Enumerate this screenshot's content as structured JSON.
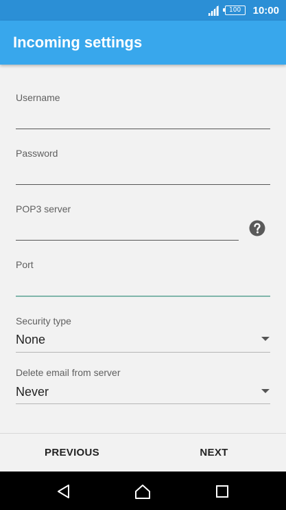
{
  "status_bar": {
    "battery_level": "100",
    "time": "10:00",
    "icons": [
      "signal-icon",
      "battery-icon"
    ]
  },
  "app_bar": {
    "title": "Incoming settings"
  },
  "form": {
    "username": {
      "label": "Username",
      "value": ""
    },
    "password": {
      "label": "Password",
      "value": ""
    },
    "pop3_server": {
      "label": "POP3 server",
      "value": "",
      "help_icon": "help-icon"
    },
    "port": {
      "label": "Port",
      "value": ""
    },
    "security_type": {
      "label": "Security type",
      "selected": "None"
    },
    "delete_email": {
      "label": "Delete email from server",
      "selected": "Never"
    }
  },
  "actions": {
    "previous_label": "PREVIOUS",
    "next_label": "NEXT"
  },
  "nav_bar": {
    "icons": [
      "back-icon",
      "home-icon",
      "recents-icon"
    ]
  },
  "colors": {
    "status_bar": "#2b8fd6",
    "app_bar": "#38a7ec",
    "background": "#f2f2f2",
    "focus_underline": "#7fb5aa",
    "nav_bar": "#000000"
  }
}
